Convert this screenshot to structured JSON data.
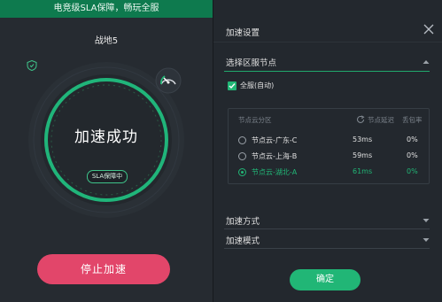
{
  "left_panel": {
    "banner": "电竞级SLA保障，畅玩全服",
    "game_name": "战地5",
    "status": "加速成功",
    "sla_badge": "SLA保障中",
    "stop_button": "停止加速"
  },
  "settings": {
    "title": "加速设置",
    "region_section": "选择区服节点",
    "all_servers_checkbox": "全服(自动)",
    "table": {
      "columns": [
        "节点云分区",
        "节点延迟",
        "丢包率"
      ],
      "rows": [
        {
          "name": "节点云-广东-C",
          "latency": "53ms",
          "loss": "0%",
          "selected": false
        },
        {
          "name": "节点云-上海-B",
          "latency": "59ms",
          "loss": "0%",
          "selected": false
        },
        {
          "name": "节点云-湖北-A",
          "latency": "61ms",
          "loss": "0%",
          "selected": true
        }
      ]
    },
    "mode_section": "加速方式",
    "model_section": "加速模式",
    "confirm_button": "确定"
  },
  "colors": {
    "accent": "#21b676",
    "stop": "#e2466a",
    "banner": "#0e7a4e"
  },
  "icons": [
    "shield-icon",
    "speed-gauge-icon",
    "close-icon",
    "chevron-up-icon",
    "chevron-down-icon",
    "refresh-icon",
    "checkbox-check-icon"
  ]
}
